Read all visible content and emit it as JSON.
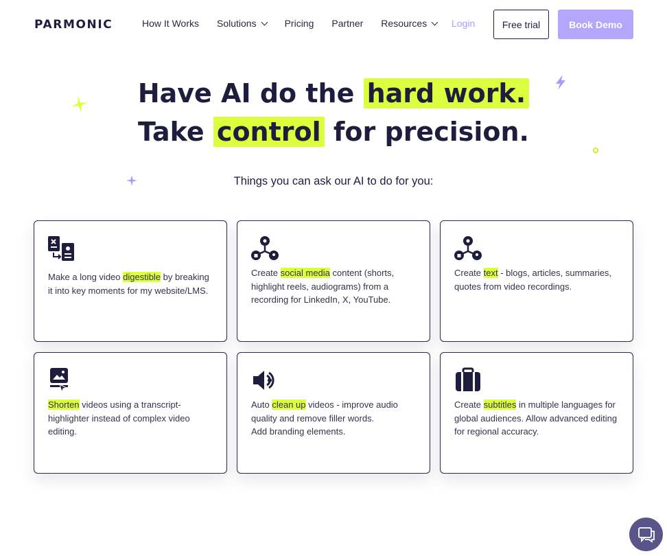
{
  "nav": {
    "logo": "PARMONIC",
    "links": [
      {
        "label": "How It Works"
      },
      {
        "label": "Solutions"
      },
      {
        "label": "Pricing"
      },
      {
        "label": "Partner"
      },
      {
        "label": "Resources"
      }
    ],
    "login": "Login",
    "free_trial": "Free trial",
    "book_demo": "Book Demo"
  },
  "hero": {
    "line1_pre": "Have AI do the ",
    "line1_highlight": "hard work.",
    "line2_pre": "Take ",
    "line2_highlight": "control",
    "line2_post": " for precision.",
    "subtitle": "Things you can ask our AI to do for you:"
  },
  "cards": [
    {
      "icon": "key-moments-icon",
      "pre": "Make a long video ",
      "highlight": "digestible",
      "post": " by breaking it into key moments for my website/LMS."
    },
    {
      "icon": "social-share-icon",
      "pre": "Create ",
      "highlight": "social media",
      "post": " content (shorts, highlight reels, audiograms) from a recording for LinkedIn, X, YouTube."
    },
    {
      "icon": "text-share-icon",
      "pre": "Create ",
      "highlight": "text",
      "post": " - blogs, articles, summaries, quotes from video recordings."
    },
    {
      "icon": "video-edit-icon",
      "pre": "",
      "highlight": "Shorten",
      "post": " videos using a transcript-highlighter instead of complex video editing."
    },
    {
      "icon": "audio-clean-icon",
      "pre": "Auto ",
      "highlight": "clean up",
      "post": " videos - improve audio quality and remove filler words.",
      "line2": "Add branding elements."
    },
    {
      "icon": "subtitles-icon",
      "pre": "Create ",
      "highlight": "subtitles",
      "post": " in multiple languages for global audiences. Allow advanced editing for regional accuracy."
    }
  ],
  "colors": {
    "accent_lime": "#dbff3e",
    "accent_purple": "#b3a6fb",
    "dark": "#1f1d3d",
    "chat_button": "#5a5589"
  }
}
